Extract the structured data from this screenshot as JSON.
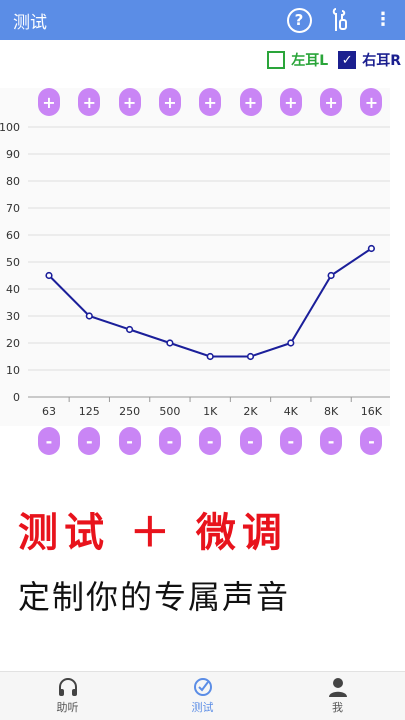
{
  "appbar": {
    "title": "测试",
    "help_icon": "question-circle-icon",
    "ear_device_icon": "earphone-icon",
    "more_icon": "more-vertical-icon",
    "help_glyph": "?",
    "more_glyph": "⋮"
  },
  "ears": {
    "left": {
      "label": "左耳L",
      "checked": false,
      "color": "#2aa53a"
    },
    "right": {
      "label": "右耳R",
      "checked": true,
      "check_glyph": "✓",
      "color": "#1b1f8f"
    }
  },
  "buttons": {
    "plus_label": "+",
    "minus_label": "-"
  },
  "chart_data": {
    "type": "line",
    "categories": [
      "63",
      "125",
      "250",
      "500",
      "1K",
      "2K",
      "4K",
      "8K",
      "16K"
    ],
    "series": [
      {
        "values": [
          45,
          30,
          25,
          20,
          15,
          15,
          20,
          45,
          55
        ],
        "color": "#1b1f9a"
      }
    ],
    "y_ticks": [
      0,
      10,
      20,
      30,
      40,
      50,
      60,
      70,
      80,
      90,
      100
    ],
    "ylim": [
      0,
      100
    ],
    "grid": true
  },
  "promo": {
    "headline": "测试 ＋ 微调",
    "subline": "定制你的专属声音"
  },
  "bottom_nav": {
    "items": [
      {
        "label": "助听",
        "icon": "headphones-icon",
        "active": false
      },
      {
        "label": "测试",
        "icon": "check-circle-icon",
        "active": true
      },
      {
        "label": "我",
        "icon": "user-icon",
        "active": false
      }
    ]
  },
  "colors": {
    "primary": "#5b8de6",
    "button": "#c985f5",
    "promo_red": "#e8131c"
  }
}
